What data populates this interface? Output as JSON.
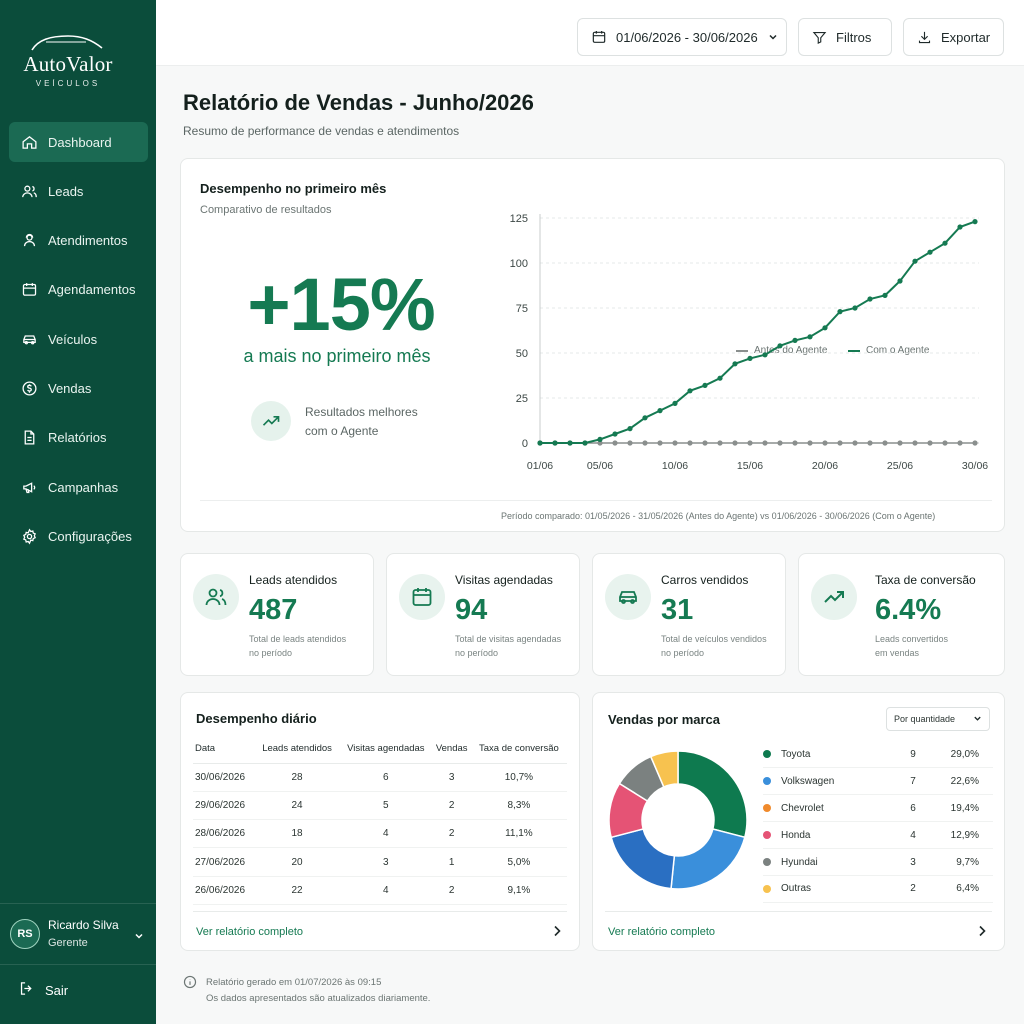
{
  "app": {
    "brand": "AutoValor",
    "brand_sub": "VEÍCULOS"
  },
  "sidebar": {
    "items": [
      {
        "label": "Dashboard",
        "icon": "home-icon",
        "active": true
      },
      {
        "label": "Leads",
        "icon": "users-icon"
      },
      {
        "label": "Atendimentos",
        "icon": "support-icon"
      },
      {
        "label": "Agendamentos",
        "icon": "calendar-icon"
      },
      {
        "label": "Veículos",
        "icon": "car-icon"
      },
      {
        "label": "Vendas",
        "icon": "dollar-icon"
      },
      {
        "label": "Relatórios",
        "icon": "document-icon"
      },
      {
        "label": "Campanhas",
        "icon": "megaphone-icon"
      },
      {
        "label": "Configurações",
        "icon": "gear-icon"
      }
    ],
    "user": {
      "initials": "RS",
      "name": "Ricardo Silva",
      "role": "Gerente"
    },
    "logout_label": "Sair"
  },
  "topbar": {
    "date_range": "01/06/2026 - 30/06/2026",
    "filters_label": "Filtros",
    "export_label": "Exportar"
  },
  "page": {
    "title": "Relatório de Vendas - Junho/2026",
    "subtitle": "Resumo de performance de vendas e atendimentos"
  },
  "performance": {
    "title": "Desempenho no primeiro mês",
    "subtitle": "Comparativo de resultados",
    "big_value": "+15%",
    "big_caption": "a mais no primeiro mês",
    "note_line1": "Resultados melhores",
    "note_line2": "com o Agente",
    "footnote": "Período comparado: 01/05/2026 - 31/05/2026 (Antes do Agente) vs 01/06/2026 - 30/06/2026 (Com o Agente)"
  },
  "chart_data": {
    "type": "line",
    "x": [
      "01/06",
      "02/06",
      "03/06",
      "04/06",
      "05/06",
      "06/06",
      "07/06",
      "08/06",
      "09/06",
      "10/06",
      "11/06",
      "12/06",
      "13/06",
      "14/06",
      "15/06",
      "16/06",
      "17/06",
      "18/06",
      "19/06",
      "20/06",
      "21/06",
      "22/06",
      "23/06",
      "24/06",
      "25/06",
      "26/06",
      "27/06",
      "28/06",
      "29/06",
      "30/06"
    ],
    "x_tick_labels": [
      "01/06",
      "05/06",
      "10/06",
      "15/06",
      "20/06",
      "25/06",
      "30/06"
    ],
    "series": [
      {
        "name": "Antes do Agente",
        "color": "#8a8f8e",
        "values": [
          0,
          0,
          0,
          0,
          0,
          0,
          0,
          0,
          0,
          0,
          0,
          0,
          0,
          0,
          0,
          0,
          0,
          0,
          0,
          0,
          0,
          0,
          0,
          0,
          0,
          0,
          0,
          0,
          0,
          0
        ]
      },
      {
        "name": "Com o Agente",
        "color": "#157a52",
        "values": [
          0,
          0,
          0,
          0,
          2,
          5,
          8,
          14,
          18,
          22,
          29,
          32,
          36,
          44,
          47,
          49,
          54,
          57,
          59,
          64,
          73,
          75,
          80,
          82,
          90,
          101,
          106,
          111,
          120,
          123
        ]
      }
    ],
    "ylim": [
      0,
      125
    ],
    "y_ticks": [
      0,
      25,
      50,
      75,
      100,
      125
    ],
    "grid": true,
    "legend_position": "top-right"
  },
  "kpis": [
    {
      "label": "Leads atendidos",
      "value": "487",
      "desc1": "Total de leads atendidos",
      "desc2": "no período",
      "icon": "users-icon"
    },
    {
      "label": "Visitas agendadas",
      "value": "94",
      "desc1": "Total de visitas agendadas",
      "desc2": "no período",
      "icon": "calendar-icon"
    },
    {
      "label": "Carros vendidos",
      "value": "31",
      "desc1": "Total de veículos vendidos",
      "desc2": "no período",
      "icon": "car-icon"
    },
    {
      "label": "Taxa de conversão",
      "value": "6.4%",
      "desc1": "Leads convertidos",
      "desc2": "em vendas",
      "icon": "trend-up-icon"
    }
  ],
  "daily": {
    "title": "Desempenho diário",
    "columns": [
      "Data",
      "Leads atendidos",
      "Visitas agendadas",
      "Vendas",
      "Taxa de conversão"
    ],
    "rows": [
      [
        "30/06/2026",
        "28",
        "6",
        "3",
        "10,7%"
      ],
      [
        "29/06/2026",
        "24",
        "5",
        "2",
        "8,3%"
      ],
      [
        "28/06/2026",
        "18",
        "4",
        "2",
        "11,1%"
      ],
      [
        "27/06/2026",
        "20",
        "3",
        "1",
        "5,0%"
      ],
      [
        "26/06/2026",
        "22",
        "4",
        "2",
        "9,1%"
      ]
    ],
    "link": "Ver relatório completo"
  },
  "brands": {
    "title": "Vendas por marca",
    "select_value": "Por quantidade",
    "items": [
      {
        "name": "Toyota",
        "count": "9",
        "pct": "29,0%",
        "value": 9,
        "color": "#0e7a4f"
      },
      {
        "name": "Volkswagen",
        "count": "7",
        "pct": "22,6%",
        "value": 7,
        "color": "#3a8fdb"
      },
      {
        "name": "Chevrolet",
        "count": "6",
        "pct": "19,4%",
        "value": 6,
        "color": "#2a6fc2"
      },
      {
        "name": "Honda",
        "count": "4",
        "pct": "12,9%",
        "value": 4,
        "color": "#e55375"
      },
      {
        "name": "Hyundai",
        "count": "3",
        "pct": "9,7%",
        "value": 3,
        "color": "#7b8180"
      },
      {
        "name": "Outras",
        "count": "2",
        "pct": "6,4%",
        "value": 2,
        "color": "#f7c24f"
      }
    ],
    "legend_colors": [
      "#0e7a4f",
      "#3a8fdb",
      "#f08a2c",
      "#e55375",
      "#7b8180",
      "#f7c24f"
    ],
    "link": "Ver relatório completo"
  },
  "footer": {
    "line1": "Relatório gerado em 01/07/2026 às 09:15",
    "line2": "Os dados apresentados são atualizados diariamente."
  }
}
